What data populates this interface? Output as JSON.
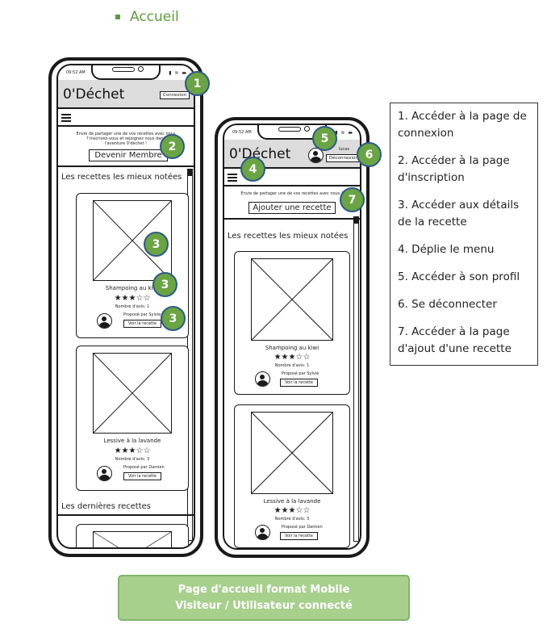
{
  "section_title": "Accueil",
  "phone_visitor": {
    "time": "09:52 AM",
    "brand": "0'Déchet",
    "login_button": "Connexion",
    "invite_text": "Envie de partager une de vos recettes avec nous ? Inscrivez-vous et rejoignez nous dans l'aventure 0'déchet !",
    "signup_button": "Devenir Membre",
    "top_heading": "Les recettes les mieux notées",
    "recipes": [
      {
        "title": "Shampoing au kiwi",
        "stars": "★★★☆☆",
        "reviews": "Nombre d'avis: 1",
        "author": "Proposé par Sylvie",
        "button": "Voir la recette"
      },
      {
        "title": "Lessive à la lavande",
        "stars": "★★★☆☆",
        "reviews": "Nombre d'avis: 3",
        "author": "Proposé par Damien",
        "button": "Voir la recette"
      }
    ],
    "latest_heading": "Les dernières recettes"
  },
  "phone_user": {
    "time": "09:52 AM",
    "brand": "0'Déchet",
    "username": "lucas",
    "logout_button": "Déconnexion",
    "invite_text": "Envie de partager une de vos recettes avec nous ?",
    "add_button": "Ajouter une recette",
    "top_heading": "Les recettes les mieux notées",
    "recipes": [
      {
        "title": "Shampoing au kiwi",
        "stars": "★★★☆☆",
        "reviews": "Nombre d'avis: 1",
        "author": "Proposé par Sylvie",
        "button": "Voir la recette"
      },
      {
        "title": "Lessive à la lavande",
        "stars": "★★★☆☆",
        "reviews": "Nombre d'avis: 3",
        "author": "Proposé par Damien",
        "button": "Voir la recette"
      }
    ]
  },
  "markers": [
    "1",
    "2",
    "3",
    "3",
    "3",
    "4",
    "5",
    "6",
    "7"
  ],
  "legend": [
    "1. Accéder à la page de connexion",
    "2. Accéder à la page d'inscription",
    "3. Accéder aux détails de la recette",
    "4. Déplie le menu",
    "5. Accéder à son profil",
    "6. Se déconnecter",
    "7. Accéder à la page d'ajout d'une recette"
  ],
  "caption": {
    "line1": "Page d'accueil format Mobile",
    "line2": "Visiteur / Utilisateur connecté"
  },
  "colors": {
    "marker": "#6aa443",
    "caption_bg": "#a8d08d",
    "section": "#5c9e3c"
  }
}
